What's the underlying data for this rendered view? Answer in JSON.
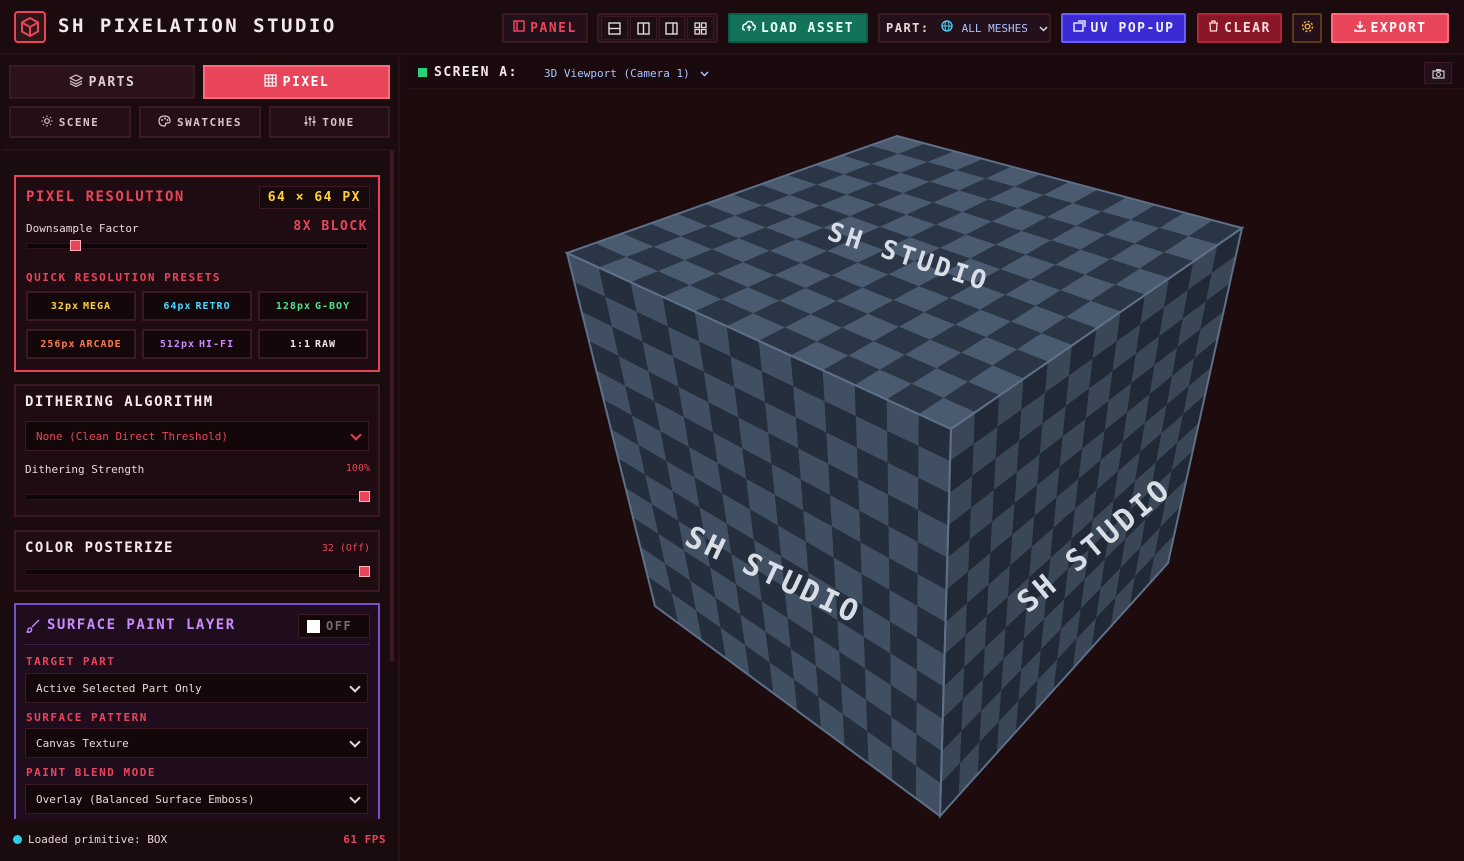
{
  "app": {
    "title": "SH PIXELATION STUDIO"
  },
  "toolbar": {
    "panel": "PANEL",
    "load_asset": "LOAD ASSET",
    "part_label": "PART:",
    "part_value": "ALL MESHES",
    "uv_popup": "UV POP-UP",
    "clear": "CLEAR",
    "export": "EXPORT"
  },
  "tabs": {
    "parts": "PARTS",
    "pixel": "PIXEL"
  },
  "subtabs": {
    "scene": "SCENE",
    "swatches": "SWATCHES",
    "tone": "TONE"
  },
  "pixel_resolution": {
    "title": "PIXEL RESOLUTION",
    "size_badge": "64 × 64 PX",
    "downsample_label": "Downsample Factor",
    "downsample_value": "8x BLOCK",
    "slider_fraction": 0.13,
    "presets_title": "QUICK RESOLUTION PRESETS",
    "presets": [
      {
        "size": "32px",
        "name": "MEGA",
        "color": "#ffd23a"
      },
      {
        "size": "64px",
        "name": "RETRO",
        "color": "#4ad7ff"
      },
      {
        "size": "128px",
        "name": "G-BOY",
        "color": "#54e08a"
      },
      {
        "size": "256px",
        "name": "ARCADE",
        "color": "#ff7a4a"
      },
      {
        "size": "512px",
        "name": "HI-FI",
        "color": "#c88cff"
      },
      {
        "size": "1:1",
        "name": "RAW",
        "color": "#f3e9ea"
      }
    ]
  },
  "dithering": {
    "title": "DITHERING ALGORITHM",
    "selected": "None (Clean Direct Threshold)",
    "strength_label": "Dithering Strength",
    "strength_value": "100%",
    "strength_fraction": 1.0
  },
  "posterize": {
    "title": "COLOR POSTERIZE",
    "value": "32 (Off)",
    "fraction": 1.0
  },
  "surface_paint": {
    "title": "SURFACE PAINT LAYER",
    "toggle": "OFF",
    "target_title": "TARGET PART",
    "target_value": "Active Selected Part Only",
    "pattern_title": "SURFACE PATTERN",
    "pattern_value": "Canvas Texture",
    "blend_title": "PAINT BLEND MODE",
    "blend_value": "Overlay (Balanced Surface Emboss)"
  },
  "status": {
    "text": "Loaded primitive: BOX",
    "fps": "61 FPS"
  },
  "viewport": {
    "screen_label": "SCREEN A:",
    "camera": "3D Viewport (Camera 1)",
    "cube_text": "SH STUDIO",
    "cube_light": "#4a5b70",
    "cube_dark": "#2a3545"
  },
  "colors": {
    "accent": "#e8455a",
    "bg": "#1a0b0e",
    "purple": "#7b4bd0",
    "green": "#12725a"
  }
}
